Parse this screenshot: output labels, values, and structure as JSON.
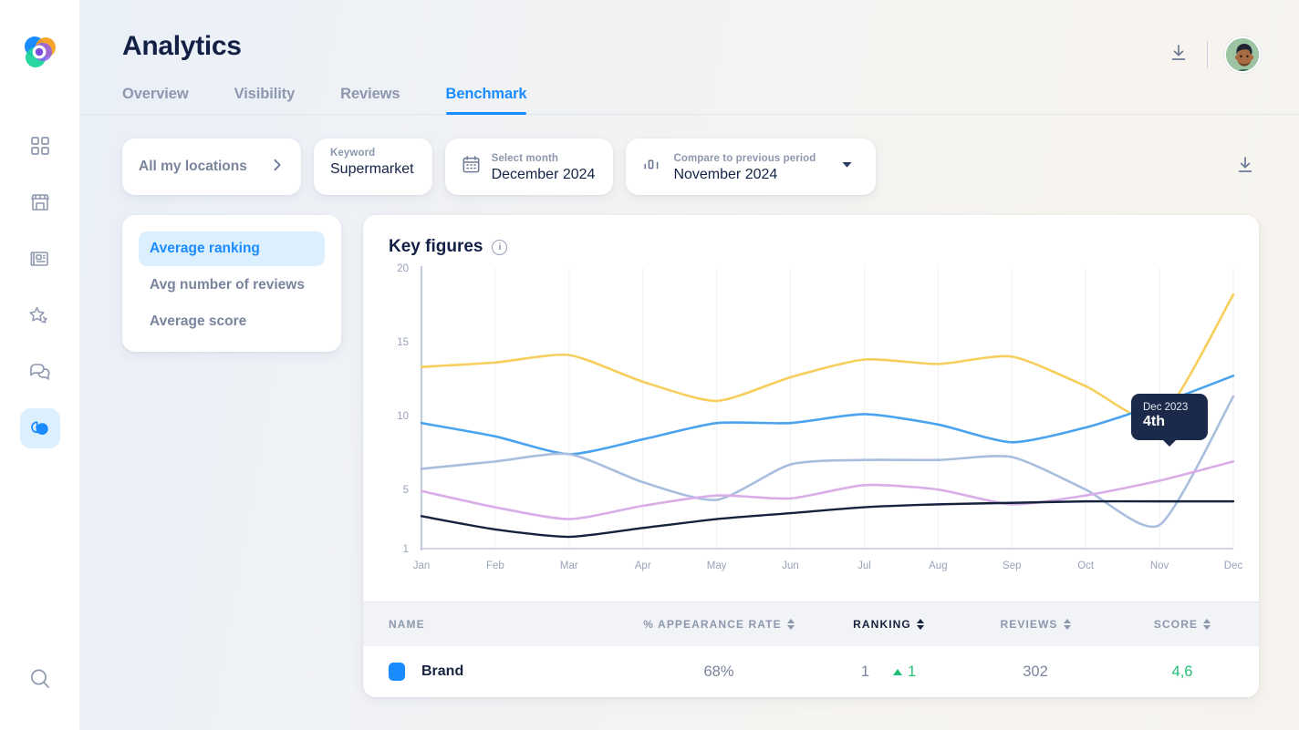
{
  "brand": {
    "logo_name": "partoo-logo"
  },
  "sidebar": {
    "items": [
      {
        "name": "dashboard",
        "icon": "grid-icon",
        "active": false
      },
      {
        "name": "locations",
        "icon": "store-icon",
        "active": false
      },
      {
        "name": "posts",
        "icon": "news-icon",
        "active": false
      },
      {
        "name": "reviews",
        "icon": "star-icon",
        "active": false
      },
      {
        "name": "messages",
        "icon": "chat-icon",
        "active": false
      },
      {
        "name": "analytics",
        "icon": "pie-chart-icon",
        "active": true
      }
    ],
    "search": {
      "icon": "search-icon"
    }
  },
  "header": {
    "title": "Analytics",
    "download_icon": "download-icon",
    "avatar_icon": "user-avatar"
  },
  "tabs": [
    {
      "label": "Overview",
      "active": false
    },
    {
      "label": "Visibility",
      "active": false
    },
    {
      "label": "Reviews",
      "active": false
    },
    {
      "label": "Benchmark",
      "active": true
    }
  ],
  "filters": {
    "locations": {
      "label": "All my locations",
      "chevron": "chevron-right-icon"
    },
    "keyword": {
      "caption": "Keyword",
      "value": "Supermarket"
    },
    "month": {
      "caption": "Select month",
      "value": "December 2024",
      "icon": "calendar-icon"
    },
    "compare": {
      "caption": "Compare to previous period",
      "value": "November 2024",
      "icon": "bar-chart-icon",
      "chevron": "chevron-down-icon"
    },
    "download_icon": "download-icon"
  },
  "metrics": [
    {
      "label": "Average ranking",
      "active": true
    },
    {
      "label": "Avg number of reviews",
      "active": false
    },
    {
      "label": "Average score",
      "active": false
    }
  ],
  "chart": {
    "title": "Key figures",
    "info_icon": "info-icon",
    "tooltip": {
      "date": "Dec 2023",
      "value": "4th"
    }
  },
  "chart_data": {
    "type": "line",
    "title": "Key figures",
    "xlabel": "",
    "ylabel": "",
    "categories": [
      "Jan",
      "Feb",
      "Mar",
      "Apr",
      "May",
      "Jun",
      "Jul",
      "Aug",
      "Sep",
      "Oct",
      "Nov",
      "Dec"
    ],
    "ylim": [
      1,
      20
    ],
    "yticks": [
      1,
      5,
      10,
      15,
      20
    ],
    "grid": true,
    "legend": "none",
    "series": [
      {
        "name": "competitor-yellow",
        "color": "#f7ce5b",
        "values": [
          13.3,
          13.6,
          14.1,
          12.3,
          11.0,
          12.6,
          13.8,
          13.5,
          14.0,
          12.0,
          9.8,
          18.2
        ]
      },
      {
        "name": "brand-blue",
        "color": "#4aa3ee",
        "values": [
          9.5,
          8.6,
          7.4,
          8.4,
          9.5,
          9.5,
          10.1,
          9.4,
          8.2,
          9.2,
          10.8,
          12.7
        ]
      },
      {
        "name": "competitor-steel",
        "color": "#a9bede",
        "values": [
          6.4,
          6.9,
          7.4,
          5.5,
          4.3,
          6.7,
          7.0,
          7.0,
          7.2,
          5.0,
          2.6,
          11.3
        ]
      },
      {
        "name": "competitor-violet",
        "color": "#d9aee8",
        "values": [
          4.9,
          3.8,
          3.0,
          3.9,
          4.6,
          4.4,
          5.3,
          5.0,
          4.0,
          4.6,
          5.6,
          6.9
        ]
      },
      {
        "name": "competitor-navy",
        "color": "#16233f",
        "values": [
          3.2,
          2.3,
          1.8,
          2.4,
          3.0,
          3.4,
          3.8,
          4.0,
          4.1,
          4.2,
          4.2,
          4.2
        ]
      }
    ]
  },
  "table": {
    "columns": [
      {
        "label": "NAME",
        "sortable": false,
        "active": false
      },
      {
        "label": "% APPEARANCE RATE",
        "sortable": true,
        "active": false
      },
      {
        "label": "RANKING",
        "sortable": true,
        "active": true
      },
      {
        "label": "REVIEWS",
        "sortable": true,
        "active": false
      },
      {
        "label": "SCORE",
        "sortable": true,
        "active": false
      }
    ],
    "rows": [
      {
        "color": "#1a8cff",
        "name": "Brand",
        "appearance_rate": "68%",
        "ranking": "1",
        "ranking_delta": "1",
        "ranking_delta_dir": "up",
        "reviews": "302",
        "score": "4,6"
      }
    ]
  }
}
